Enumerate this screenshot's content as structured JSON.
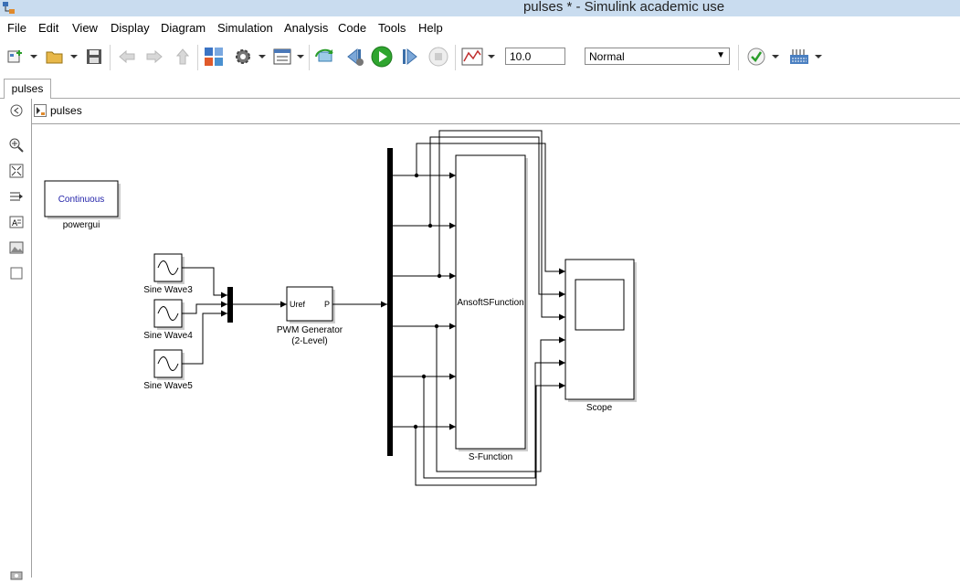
{
  "window": {
    "title": "pulses * - Simulink academic use"
  },
  "menu": [
    "File",
    "Edit",
    "View",
    "Display",
    "Diagram",
    "Simulation",
    "Analysis",
    "Code",
    "Tools",
    "Help"
  ],
  "toolbar": {
    "stop_time": "10.0",
    "sim_mode": "Normal"
  },
  "tabs": [
    "pulses"
  ],
  "breadcrumb": "pulses",
  "diagram": {
    "powergui": {
      "label": "Continuous",
      "name": "powergui"
    },
    "sine_waves": [
      "Sine Wave3",
      "Sine Wave4",
      "Sine Wave5"
    ],
    "pwm": {
      "in_port": "Uref",
      "out_port": "P",
      "name_line1": "PWM Generator",
      "name_line2": "(2-Level)"
    },
    "sfunction": {
      "label": "AnsoftSFunction",
      "name": "S-Function"
    },
    "scope": {
      "name": "Scope"
    }
  }
}
